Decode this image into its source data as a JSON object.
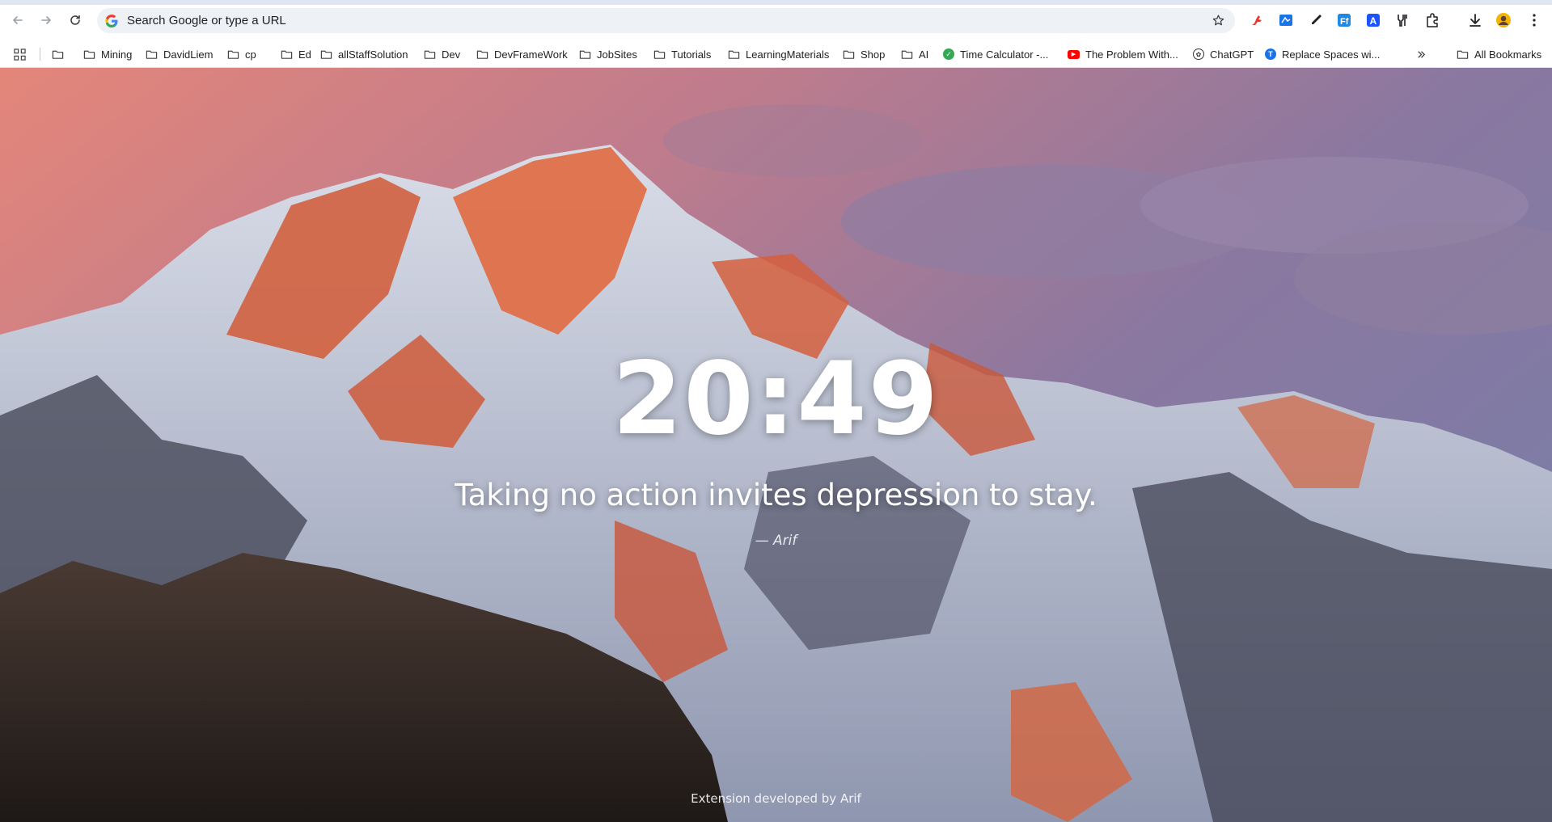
{
  "browser": {
    "omnibox": {
      "placeholder": "Search Google or type a URL"
    },
    "extensions": [
      {
        "icon": "red-hand-icon",
        "color": "#e53935"
      },
      {
        "icon": "screenshot-icon",
        "color": "#1a73e8"
      },
      {
        "icon": "eyedropper-icon",
        "color": "#202124"
      },
      {
        "icon": "font-finder-icon",
        "color": "#1e88e5"
      },
      {
        "icon": "translate-icon",
        "color": "#1a53ff"
      },
      {
        "icon": "tools-icon",
        "color": "#202124"
      },
      {
        "icon": "puzzle-icon",
        "color": "#202124"
      }
    ]
  },
  "bookmarks": {
    "items": [
      {
        "label": "",
        "type": "folder"
      },
      {
        "label": "Mining",
        "type": "folder"
      },
      {
        "label": "DavidLiem",
        "type": "folder"
      },
      {
        "label": "cp",
        "type": "folder"
      },
      {
        "label": "Ed",
        "type": "folder"
      },
      {
        "label": "allStaffSolution",
        "type": "folder"
      },
      {
        "label": "Dev",
        "type": "folder"
      },
      {
        "label": "DevFrameWork",
        "type": "folder"
      },
      {
        "label": "JobSites",
        "type": "folder"
      },
      {
        "label": "Tutorials",
        "type": "folder"
      },
      {
        "label": "LearningMaterials",
        "type": "folder"
      },
      {
        "label": "Shop",
        "type": "folder"
      },
      {
        "label": "AI",
        "type": "folder"
      },
      {
        "label": "Time Calculator -...",
        "type": "link",
        "icon": "green-check-icon"
      },
      {
        "label": "The Problem With...",
        "type": "link",
        "icon": "youtube-icon"
      },
      {
        "label": "ChatGPT",
        "type": "link",
        "icon": "openai-icon"
      },
      {
        "label": "Replace Spaces wi...",
        "type": "link",
        "icon": "t-letter-icon"
      }
    ],
    "all_bookmarks": "All Bookmarks"
  },
  "newtab": {
    "time": "20:49",
    "quote": "Taking no action invites depression to stay.",
    "author": "— Arif",
    "footer": "Extension developed by Arif"
  }
}
